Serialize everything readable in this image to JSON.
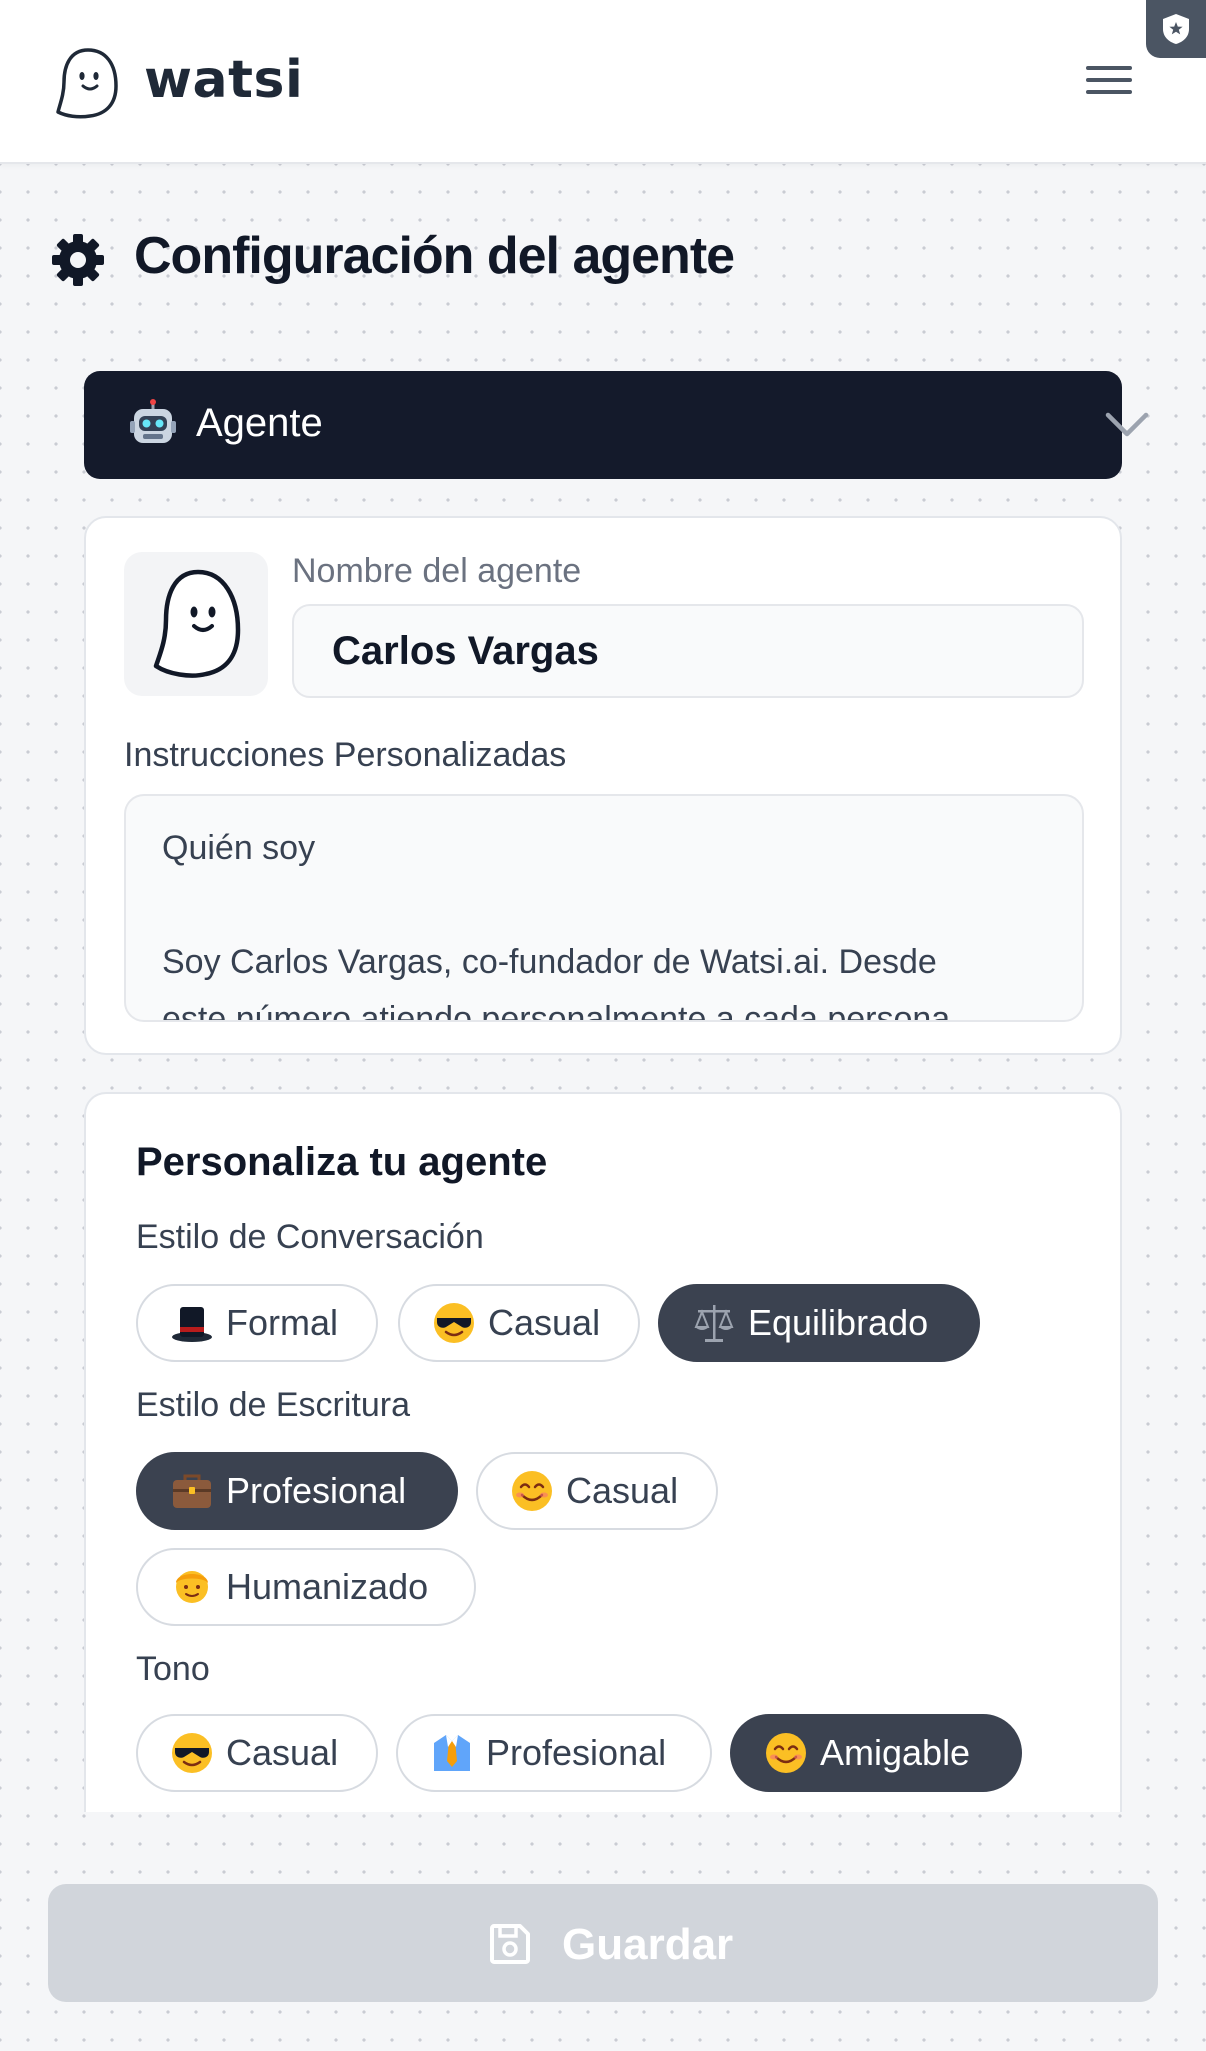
{
  "header": {
    "brand": "watsi",
    "icons": [
      "ghost-logo-icon",
      "hamburger-menu-icon",
      "extension-shield-icon"
    ]
  },
  "page": {
    "title": "Configuración del agente",
    "title_icon": "gear-icon"
  },
  "agent_selector": {
    "icon": "robot-emoji",
    "label": "Agente"
  },
  "agent_card": {
    "name_label": "Nombre del agente",
    "name_value": "Carlos Vargas",
    "instructions_label": "Instrucciones Personalizadas",
    "instructions_lines": [
      "Quién soy",
      "",
      "Soy Carlos Vargas, co-fundador de Watsi.ai. Desde",
      "este número atiendo personalmente a cada persona"
    ]
  },
  "personalize": {
    "title": "Personaliza tu agente",
    "conversation": {
      "label": "Estilo de Conversación",
      "options": [
        {
          "icon": "top-hat-emoji",
          "label": "Formal",
          "selected": false
        },
        {
          "icon": "sunglasses-face-emoji",
          "label": "Casual",
          "selected": false
        },
        {
          "icon": "balance-scale-emoji",
          "label": "Equilibrado",
          "selected": true
        }
      ]
    },
    "writing": {
      "label": "Estilo de Escritura",
      "options": [
        {
          "icon": "briefcase-emoji",
          "label": "Profesional",
          "selected": true
        },
        {
          "icon": "smiling-face-emoji",
          "label": "Casual",
          "selected": false
        },
        {
          "icon": "person-emoji",
          "label": "Humanizado",
          "selected": false
        }
      ]
    },
    "tone": {
      "label": "Tono",
      "options": [
        {
          "icon": "sunglasses-face-emoji",
          "label": "Casual",
          "selected": false
        },
        {
          "icon": "necktie-shirt-emoji",
          "label": "Profesional",
          "selected": false
        },
        {
          "icon": "smiling-face-emoji",
          "label": "Amigable",
          "selected": true
        }
      ]
    }
  },
  "save_button": {
    "icon": "floppy-disk-icon",
    "label": "Guardar"
  },
  "colors": {
    "dark_navy": "#141a2b",
    "chip_active": "#3b4250",
    "save_disabled": "#d1d5db"
  }
}
